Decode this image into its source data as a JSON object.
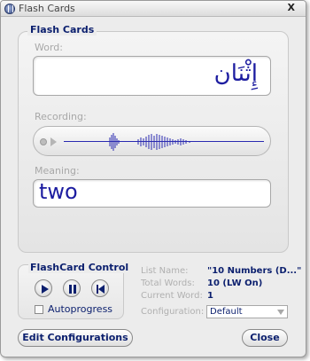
{
  "window": {
    "title": "Flash Cards",
    "close_label": "X"
  },
  "panel": {
    "legend": "Flash Cards",
    "word_label": "Word:",
    "word_value": "إِثْنَان",
    "recording_label": "Recording:",
    "meaning_label": "Meaning:",
    "meaning_value": "two"
  },
  "control": {
    "legend": "FlashCard Control",
    "autoprogress_label": "Autoprogress",
    "autoprogress_checked": false
  },
  "info": {
    "list_name_label": "List Name:",
    "list_name_value": "\"10 Numbers (D...\"",
    "total_words_label": "Total Words:",
    "total_words_value": "10 (LW On)",
    "current_word_label": "Current Word:",
    "current_word_value": "1",
    "configuration_label": "Configuration:",
    "configuration_value": "Default"
  },
  "buttons": {
    "edit_configurations": "Edit Configurations",
    "close": "Close"
  },
  "colors": {
    "accent": "#0b1f6e",
    "text_blue": "#1c1ca0",
    "muted": "#a8a8a8"
  }
}
